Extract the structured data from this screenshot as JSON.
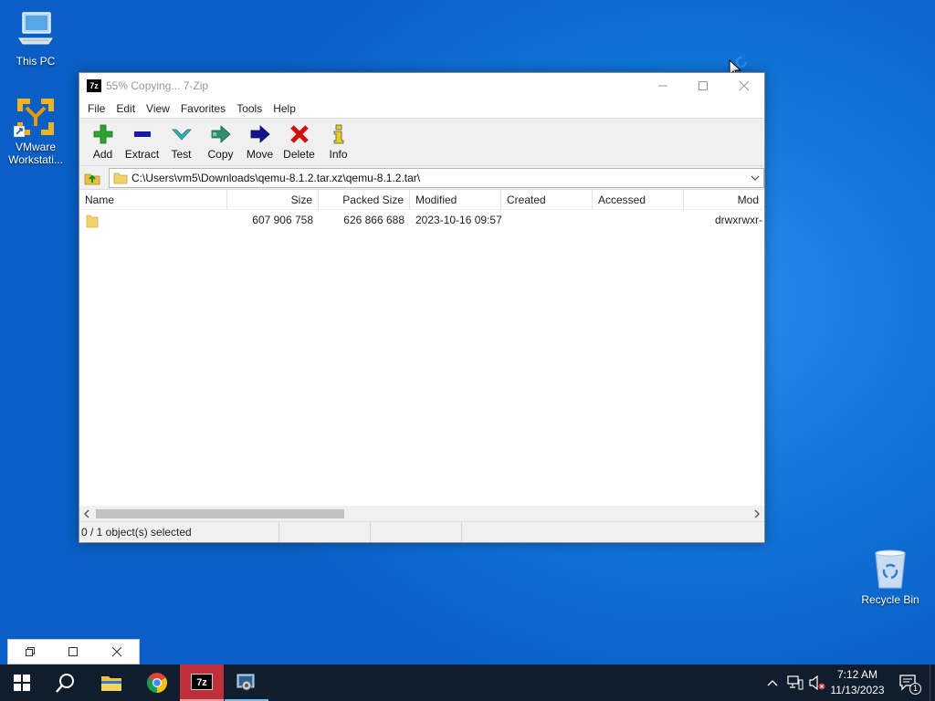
{
  "desktop": {
    "icons": [
      {
        "label": "This PC"
      },
      {
        "label": "VMware Workstati..."
      },
      {
        "label": "Recycle Bin"
      }
    ]
  },
  "window": {
    "title": "55% Copying... 7-Zip",
    "app_icon_text": "7z",
    "menu": [
      "File",
      "Edit",
      "View",
      "Favorites",
      "Tools",
      "Help"
    ],
    "toolbar": [
      "Add",
      "Extract",
      "Test",
      "Copy",
      "Move",
      "Delete",
      "Info"
    ],
    "address": "C:\\Users\\vm5\\Downloads\\qemu-8.1.2.tar.xz\\qemu-8.1.2.tar\\",
    "columns": [
      "Name",
      "Size",
      "Packed Size",
      "Modified",
      "Created",
      "Accessed",
      "Mod"
    ],
    "rows": [
      {
        "name": "",
        "size": "607 906 758",
        "packed_size": "626 866 688",
        "modified": "2023-10-16 09:57",
        "created": "",
        "accessed": "",
        "mode": "drwxrwxr-"
      }
    ],
    "status": "0 / 1 object(s) selected"
  },
  "taskbar": {
    "apps": [
      "start",
      "search",
      "file-explorer",
      "chrome",
      "7-zip",
      "vmware-tools"
    ],
    "clock_time": "7:12 AM",
    "clock_date": "11/13/2023",
    "notification_count": "1"
  },
  "colors": {
    "desktop": "#1278db",
    "taskbar": "#101d2c",
    "add": "#2ea42e",
    "extract": "#1a1aa0",
    "test": "#33b3b3",
    "delete": "#d01010"
  }
}
